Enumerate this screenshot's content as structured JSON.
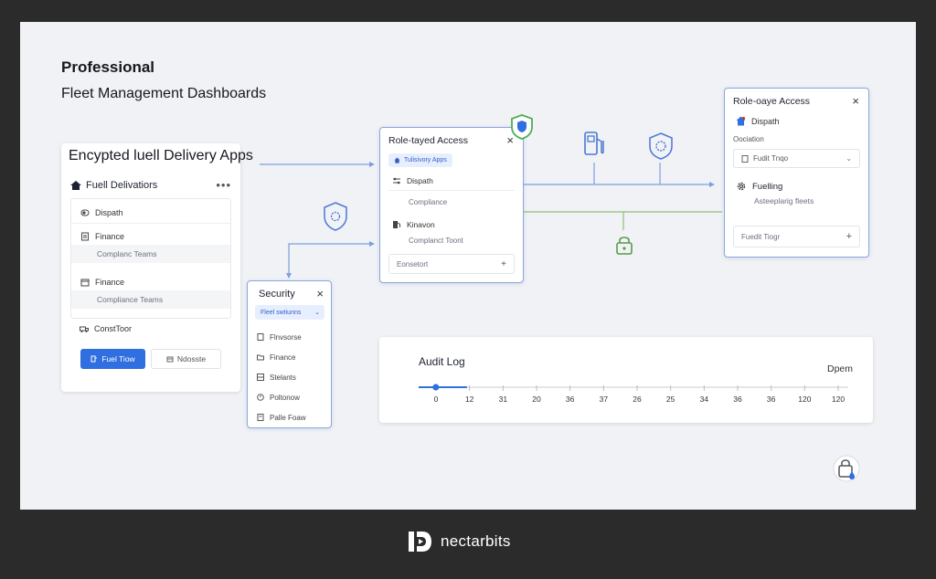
{
  "headline": {
    "line1": "Professional",
    "line2": "Fleet Management Dashboards"
  },
  "section_title": "Encypted luell Delivery Apps",
  "fuel_card": {
    "title": "Fuell Delivatiors",
    "more": "•••",
    "rows": [
      {
        "label": "Dispath",
        "icon": "toggle-icon"
      },
      {
        "label": "Finance",
        "sub": "Complanc Teams",
        "icon": "document-icon"
      },
      {
        "label": "Finance",
        "sub": "Compliance Teams",
        "icon": "calendar-icon"
      },
      {
        "label": "ConstToor",
        "icon": "truck-icon"
      }
    ],
    "primary_button": "Fuel Tiow",
    "secondary_button": "Ndosste"
  },
  "security_card": {
    "title": "Security",
    "close": "×",
    "pill": "Fleel swtiunns",
    "items": [
      "Flnvsorse",
      "Finance",
      "Stelants",
      "Poltonow",
      "Palle Foaw"
    ]
  },
  "role_card_mid": {
    "title": "Role-tayed Access",
    "close": "×",
    "tag": "Tulisivory Apps",
    "row1": "Dispath",
    "sub1": "Compliance",
    "row2": "Kinavon",
    "sub2": "Complanct Toont",
    "input": "Eonsetort",
    "plus": "+"
  },
  "role_card_right": {
    "title": "Role-oaye Access",
    "close": "×",
    "row1": "Dispath",
    "label": "Oociation",
    "select": "Fudit Tnqo",
    "chev": "⌄",
    "row2": "Fuelling",
    "sub2": "Asteeplarig fleets",
    "input": "Fuedit Tiogr",
    "plus": "+"
  },
  "audit_log": {
    "title": "Audit Log",
    "right_label": "Dpem",
    "progress": 0.04,
    "ticks": [
      "0",
      "12",
      "31",
      "20",
      "36",
      "37",
      "26",
      "25",
      "34",
      "36",
      "36",
      "120",
      "120"
    ]
  },
  "brand": {
    "name": "nectarbits"
  },
  "colors": {
    "accent": "#2f6fe0",
    "card_border": "#8aa6de",
    "connector_blue": "#7aa0e0",
    "connector_green": "#8fbf7a"
  }
}
